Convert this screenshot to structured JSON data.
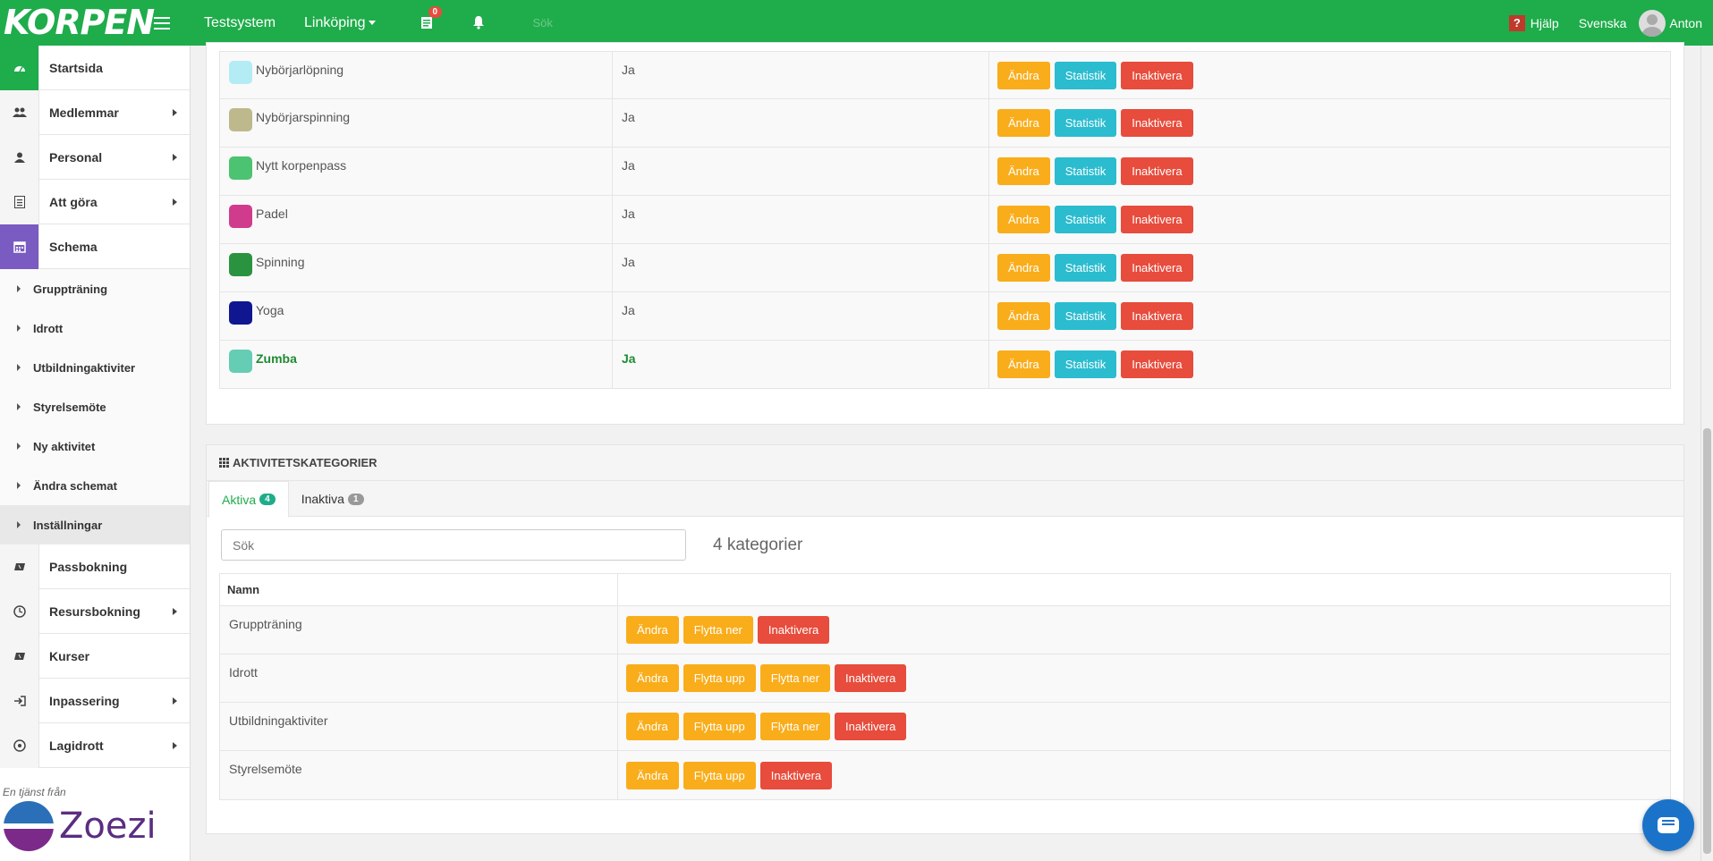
{
  "topbar": {
    "logo": "KORPEN",
    "system": "Testsystem",
    "location": "Linköping",
    "notes_badge": "0",
    "faded_text": "Sök",
    "help": "Hjälp",
    "language": "Svenska",
    "user": "Anton"
  },
  "sidebar": {
    "items": [
      {
        "label": "Startsida"
      },
      {
        "label": "Medlemmar"
      },
      {
        "label": "Personal"
      },
      {
        "label": "Att göra"
      },
      {
        "label": "Schema"
      }
    ],
    "sub_items": [
      {
        "label": "Gruppträning"
      },
      {
        "label": "Idrott"
      },
      {
        "label": "Utbildningaktiviter"
      },
      {
        "label": "Styrelsemöte"
      },
      {
        "label": "Ny aktivitet"
      },
      {
        "label": "Ändra schemat"
      },
      {
        "label": "Inställningar"
      }
    ],
    "lower_items": [
      {
        "label": "Passbokning"
      },
      {
        "label": "Resursbokning"
      },
      {
        "label": "Kurser"
      },
      {
        "label": "Inpassering"
      },
      {
        "label": "Lagidrott"
      }
    ],
    "powered_by": "En tjänst från",
    "brand": "Zoezi"
  },
  "activities": {
    "rows": [
      {
        "name": "Nybörjarlöpning",
        "color": "#b3ecf4",
        "active": "Ja"
      },
      {
        "name": "Nybörjarspinning",
        "color": "#bdb98c",
        "active": "Ja"
      },
      {
        "name": "Nytt korpenpass",
        "color": "#4cc371",
        "active": "Ja"
      },
      {
        "name": "Padel",
        "color": "#d03b8d",
        "active": "Ja"
      },
      {
        "name": "Spinning",
        "color": "#2a9340",
        "active": "Ja"
      },
      {
        "name": "Yoga",
        "color": "#0f1690",
        "active": "Ja"
      },
      {
        "name": "Zumba",
        "color": "#64cdb4",
        "active": "Ja"
      }
    ],
    "btn_edit": "Ändra",
    "btn_stats": "Statistik",
    "btn_deactivate": "Inaktivera"
  },
  "categories": {
    "title": "AKTIVITETSKATEGORIER",
    "tab_active": "Aktiva",
    "tab_active_count": "4",
    "tab_inactive": "Inaktiva",
    "tab_inactive_count": "1",
    "search_placeholder": "Sök",
    "count_text": "4 kategorier",
    "col_name": "Namn",
    "rows": [
      {
        "name": "Gruppträning"
      },
      {
        "name": "Idrott"
      },
      {
        "name": "Utbildningaktiviter"
      },
      {
        "name": "Styrelsemöte"
      }
    ],
    "btn_edit": "Ändra",
    "btn_up": "Flytta upp",
    "btn_down": "Flytta ner",
    "btn_deactivate": "Inaktivera"
  },
  "colors": {
    "brand": "#1fac4b",
    "accent_purple": "#7a5bc2",
    "warning": "#f9ad1b",
    "info": "#2bbccf",
    "danger": "#e74c3c"
  }
}
